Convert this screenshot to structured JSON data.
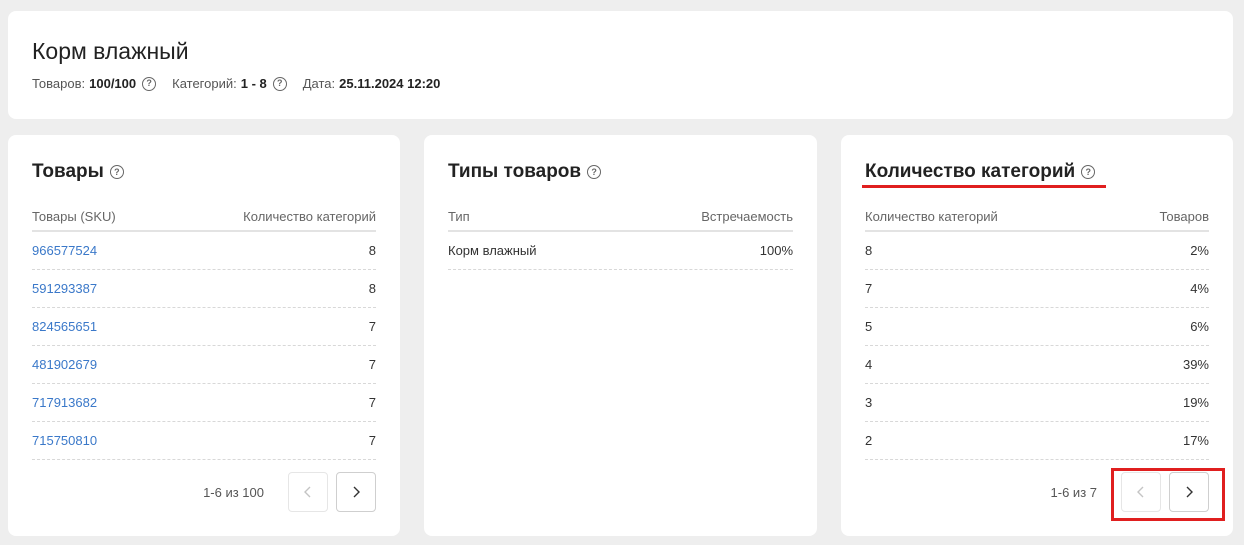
{
  "header": {
    "title": "Корм влажный",
    "goods_label": "Товаров:",
    "goods_value": "100/100",
    "categories_label": "Категорий:",
    "categories_value": "1 - 8",
    "date_label": "Дата:",
    "date_value": "25.11.2024 12:20"
  },
  "goods_panel": {
    "title": "Товары",
    "col1": "Товары (SKU)",
    "col2": "Количество категорий",
    "rows": [
      {
        "sku": "966577524",
        "count": "8"
      },
      {
        "sku": "591293387",
        "count": "8"
      },
      {
        "sku": "824565651",
        "count": "7"
      },
      {
        "sku": "481902679",
        "count": "7"
      },
      {
        "sku": "717913682",
        "count": "7"
      },
      {
        "sku": "715750810",
        "count": "7"
      }
    ],
    "pager_text": "1-6 из 100"
  },
  "types_panel": {
    "title": "Типы товаров",
    "col1": "Тип",
    "col2": "Встречаемость",
    "rows": [
      {
        "type": "Корм влажный",
        "freq": "100%"
      }
    ]
  },
  "categories_panel": {
    "title": "Количество категорий",
    "col1": "Количество категорий",
    "col2": "Товаров",
    "rows": [
      {
        "count": "8",
        "share": "2%"
      },
      {
        "count": "7",
        "share": "4%"
      },
      {
        "count": "5",
        "share": "6%"
      },
      {
        "count": "4",
        "share": "39%"
      },
      {
        "count": "3",
        "share": "19%"
      },
      {
        "count": "2",
        "share": "17%"
      }
    ],
    "pager_text": "1-6 из 7"
  },
  "icons": {
    "help": "question-circle-icon",
    "prev": "chevron-left-icon",
    "next": "chevron-right-icon"
  },
  "colors": {
    "link": "#3a78c9",
    "highlight": "#e01f1f",
    "background": "#eeeeee"
  }
}
